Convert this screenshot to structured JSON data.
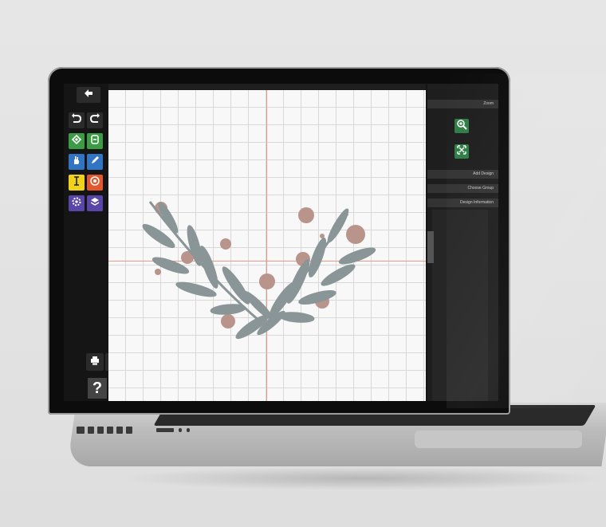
{
  "toolbar": {
    "back_icon": "arrow-left-icon",
    "undo_icon": "undo-icon",
    "redo_icon": "redo-icon",
    "help_label": "?"
  },
  "panel": {
    "zoom_header": "Zoom",
    "add_design_header": "Add Design",
    "choose_group_header": "Choose Group",
    "design_information_header": "Design Information"
  },
  "colors": {
    "leaf": "#8a9598",
    "berry": "#b8948a",
    "axis": "#e89a8a",
    "zoom_button": "#2f7d46",
    "yellow_tool": "#f0d21a",
    "orange_tool": "#e4572e",
    "purple_tool": "#5a45a8",
    "green_tool": "#3e9b45",
    "blue_tool": "#3174c4"
  }
}
